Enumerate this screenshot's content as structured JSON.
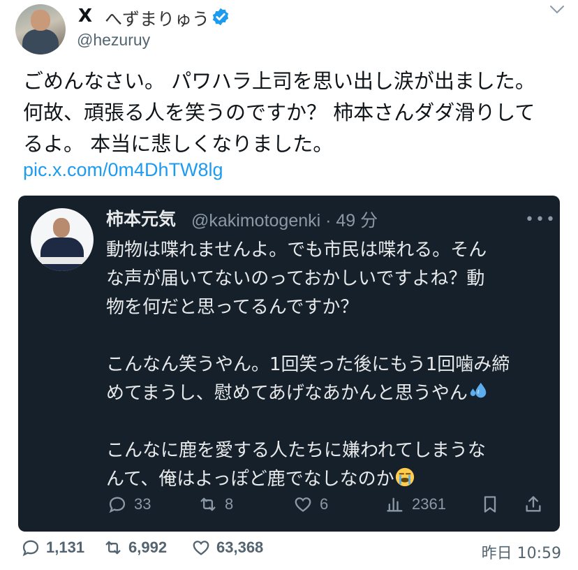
{
  "header": {
    "display_name": "へずまりゅう",
    "handle": "@hezuruy",
    "x_logo": "X"
  },
  "tweet": {
    "lines": [
      "ごめんなさい。 パワハラ上司を思い出し涙が出ました。",
      "何故、頑張る人を笑うのですか？ 柿本さんダダ滑りして",
      "るよ。 本当に悲しくなりました。"
    ],
    "link": "pic.x.com/0m4DhTW8lg"
  },
  "quoted": {
    "name": "柿本元気",
    "meta": "@kakimotogenki · 49 分",
    "lines": [
      "動物は喋れませんよ。でも市民は喋れる。そん",
      "な声が届いてないのっておかしいですよね？動",
      "物を何だと思ってるんですか？",
      "",
      "こんなん笑うやん。1回笑った後にもう1回噛み締",
      "めてまうし、慰めてあげなあかんと思うやん",
      "",
      "こんなに鹿を愛する人たちに嫌われてしまうな",
      "んて、俺はよっぽど鹿でなしなのか"
    ],
    "emojis": [
      "sweat-droplets-emoji",
      "crying-face-emoji"
    ],
    "actions": {
      "replies": "33",
      "retweets": "8",
      "likes": "6",
      "views": "2361"
    }
  },
  "footer": {
    "replies": "1,131",
    "retweets": "6,992",
    "likes": "63,368",
    "timestamp": "昨日 10:59"
  },
  "colors": {
    "link": "#1d9bf0",
    "quote_bg": "#15202b",
    "verified": "#1d9bf0"
  }
}
